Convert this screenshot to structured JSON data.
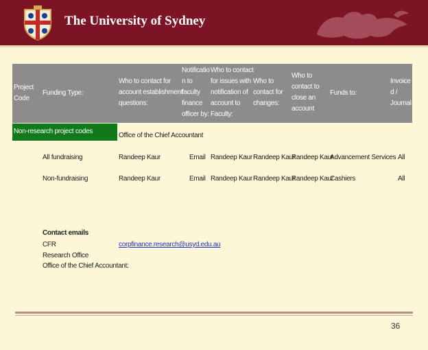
{
  "header": {
    "title": "The University of Sydney",
    "bg_color": "#7d1426"
  },
  "table": {
    "columns": [
      [
        "Project",
        "Code"
      ],
      [
        "Funding Type:"
      ],
      [
        "Who to contact for",
        "account establishment",
        "questions:"
      ],
      [
        "Notificatio",
        "n to",
        "faculty",
        "finance",
        "officer by:"
      ],
      [
        "Who to contact",
        "for issues with",
        "notification of",
        "account to",
        "Faculty:"
      ],
      [
        "Who to",
        "contact for",
        "changes:"
      ],
      [
        "Who to",
        "contact to",
        "close an",
        "account"
      ],
      [
        "Funds to:"
      ],
      [
        "Invoice",
        "d /",
        "Journal"
      ]
    ],
    "section_label": "Non-research project codes",
    "section_contact": "Office of the Chief Accountant",
    "rows": [
      [
        "All fundraising",
        "Randeep Kaur",
        "Email",
        "Randeep Kaur",
        "Randeep Kaur",
        "Randeep Kaur",
        "Advancement Services",
        "All"
      ],
      [
        "Non-fundraising",
        "Randeep Kaur",
        "Email",
        "Randeep Kaur",
        "Randeep Kaur",
        "Randeep Kaur",
        "Cashiers",
        "All"
      ]
    ]
  },
  "contacts": {
    "heading": "Contact emails",
    "items": [
      "CFR",
      "Research Office",
      "Office of the Chief Accountant:"
    ],
    "email": "corpfinance.research@usyd.edu.au"
  },
  "page_number": "36"
}
